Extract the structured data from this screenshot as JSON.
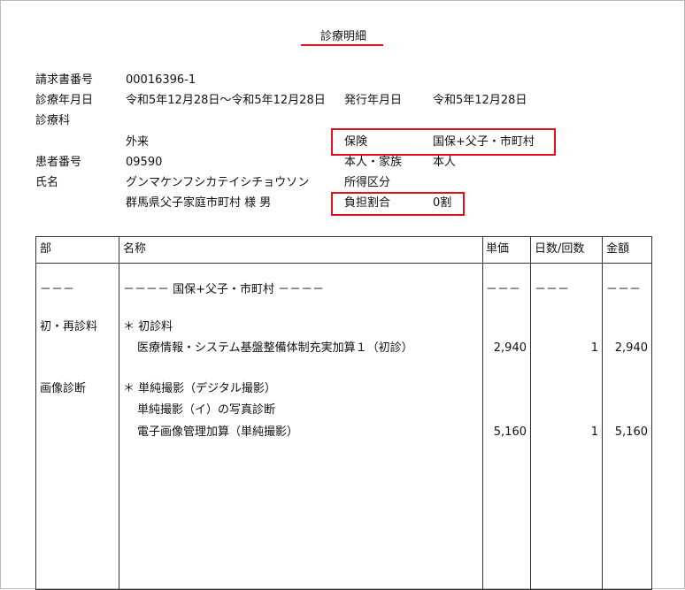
{
  "document": {
    "title": "診療明細",
    "header": {
      "invoice_no_label": "請求書番号",
      "invoice_no": "00016396-1",
      "date_label": "診療年月日",
      "date_range": "令和5年12月28日～令和5年12月28日",
      "issue_label": "発行年月日",
      "issue_date": "令和5年12月28日",
      "department_label": "診療科",
      "department": "外来",
      "insurance_label": "保険",
      "insurance": "国保+父子・市町村",
      "patient_no_label": "患者番号",
      "patient_no": "09590",
      "family_label": "本人・家族",
      "family": "本人",
      "name_label": "氏名",
      "name_kana": "グンマケンフシカテイシチョウソン",
      "income_label": "所得区分",
      "name_kanji": "群馬県父子家庭市町村 様 男",
      "copay_label": "負担割合",
      "copay": "0割"
    },
    "table": {
      "columns": [
        "部",
        "名称",
        "単価",
        "日数/回数",
        "金額"
      ],
      "divider": {
        "section": "－－－",
        "name": "－－－－ 国保+父子・市町村 －－－－",
        "unit": "－－－",
        "count": "－－－",
        "amount": "－－－"
      },
      "groups": [
        {
          "section": "初・再診料",
          "header": "＊ 初診料",
          "rows": [
            {
              "name": "医療情報・システム基盤整備体制充実加算１（初診）",
              "unit": "2,940",
              "count": "1",
              "amount": "2,940"
            }
          ]
        },
        {
          "section": "画像診断",
          "header": "＊ 単純撮影（デジタル撮影）",
          "rows": [
            {
              "name": "単純撮影（イ）の写真診断",
              "unit": "",
              "count": "",
              "amount": ""
            },
            {
              "name": "電子画像管理加算（単純撮影）",
              "unit": "5,160",
              "count": "1",
              "amount": "5,160"
            }
          ]
        }
      ]
    }
  }
}
